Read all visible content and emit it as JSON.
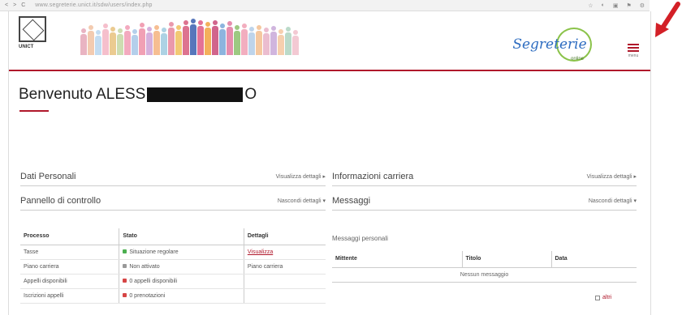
{
  "browser": {
    "url": "www.segreterie.unict.it/sdw/users/index.php",
    "nav": [
      "<",
      ">",
      "C"
    ],
    "icons": [
      "star-icon",
      "shield-icon",
      "extension-icon",
      "flag-icon",
      "menu-icon"
    ]
  },
  "header": {
    "logo_caption": "UNICT",
    "brand_title": "Segreterie",
    "brand_sub": "online",
    "menu_label": "menu"
  },
  "welcome": {
    "prefix": "Benvenuto ALESS",
    "suffix": "O"
  },
  "panels": {
    "dati_personali": {
      "title": "Dati Personali",
      "more": "Visualizza dettagli ▸"
    },
    "pannello": {
      "title": "Pannello di controllo",
      "more": "Nascondi dettagli ▾"
    },
    "info_carriera": {
      "title": "Informazioni carriera",
      "more": "Visualizza dettagli ▸"
    },
    "messaggi": {
      "title": "Messaggi",
      "more": "Nascondi dettagli ▾"
    }
  },
  "processi": {
    "headers": [
      "Processo",
      "Stato",
      "Dettagli"
    ],
    "rows": [
      {
        "processo": "Tasse",
        "stato": "Situazione regolare",
        "dettagli": "Visualizza",
        "dot": false,
        "link": true
      },
      {
        "processo": "Piano carriera",
        "stato": "Non attivato",
        "dettagli": "Piano carriera",
        "dot": false,
        "link": false
      },
      {
        "processo": "Appelli disponibili",
        "stato": "0 appelli disponibili",
        "dettagli": "",
        "dot": true,
        "link": false
      },
      {
        "processo": "Iscrizioni appelli",
        "stato": "0 prenotazioni",
        "dettagli": "",
        "dot": true,
        "link": false
      }
    ]
  },
  "messaggi": {
    "subtitle": "Messaggi personali",
    "headers": [
      "Mittente",
      "Titolo",
      "Data"
    ],
    "empty": "Nessun messaggio",
    "all_link": "altri"
  },
  "colors": {
    "accent": "#b0182b",
    "brand_blue": "#2d6cc0",
    "brand_green": "#8bc34a"
  }
}
